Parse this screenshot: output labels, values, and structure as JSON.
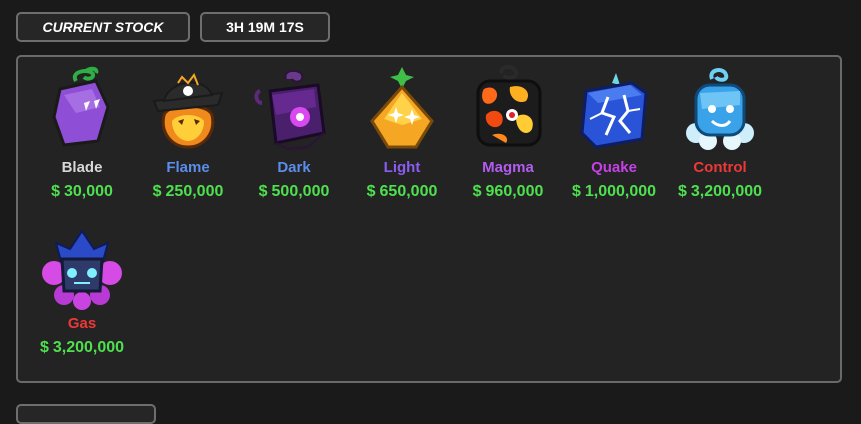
{
  "header": {
    "stock_tab_label": "CURRENT STOCK",
    "timer_label": "3H 19M 17S"
  },
  "currency_symbol": "$",
  "items": [
    {
      "name": "Blade",
      "price": "30,000",
      "name_color": "#d7d7d7",
      "icon": "blade-fruit-icon"
    },
    {
      "name": "Flame",
      "price": "250,000",
      "name_color": "#5b8dea",
      "icon": "flame-fruit-icon"
    },
    {
      "name": "Dark",
      "price": "500,000",
      "name_color": "#5b8dea",
      "icon": "dark-fruit-icon"
    },
    {
      "name": "Light",
      "price": "650,000",
      "name_color": "#8b5cf0",
      "icon": "light-fruit-icon"
    },
    {
      "name": "Magma",
      "price": "960,000",
      "name_color": "#b25cf0",
      "icon": "magma-fruit-icon"
    },
    {
      "name": "Quake",
      "price": "1,000,000",
      "name_color": "#c640e8",
      "icon": "quake-fruit-icon"
    },
    {
      "name": "Control",
      "price": "3,200,000",
      "name_color": "#ee3838",
      "icon": "control-fruit-icon"
    },
    {
      "name": "Gas",
      "price": "3,200,000",
      "name_color": "#ee3838",
      "icon": "gas-fruit-icon"
    }
  ],
  "colors": {
    "price": "#4ee04e",
    "background": "#1a1a1a",
    "panel": "#232323",
    "border": "#6a6a6a"
  }
}
